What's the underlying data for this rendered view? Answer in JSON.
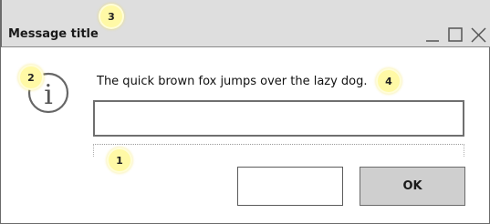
{
  "window": {
    "title": "Message title",
    "controls": [
      "minimize-icon",
      "maximize-icon",
      "close-icon"
    ]
  },
  "body": {
    "icon": "info-icon",
    "icon_glyph": "i",
    "message": "The quick brown fox jumps over the lazy dog.",
    "input_value": ""
  },
  "buttons": {
    "cancel_label": "",
    "ok_label": "OK"
  },
  "badges": {
    "b1": "1",
    "b2": "2",
    "b3": "3",
    "b4": "4"
  },
  "colors": {
    "titlebar": "#dedede",
    "ok_button": "#cfcfcf",
    "badge": "#fff9a6"
  }
}
